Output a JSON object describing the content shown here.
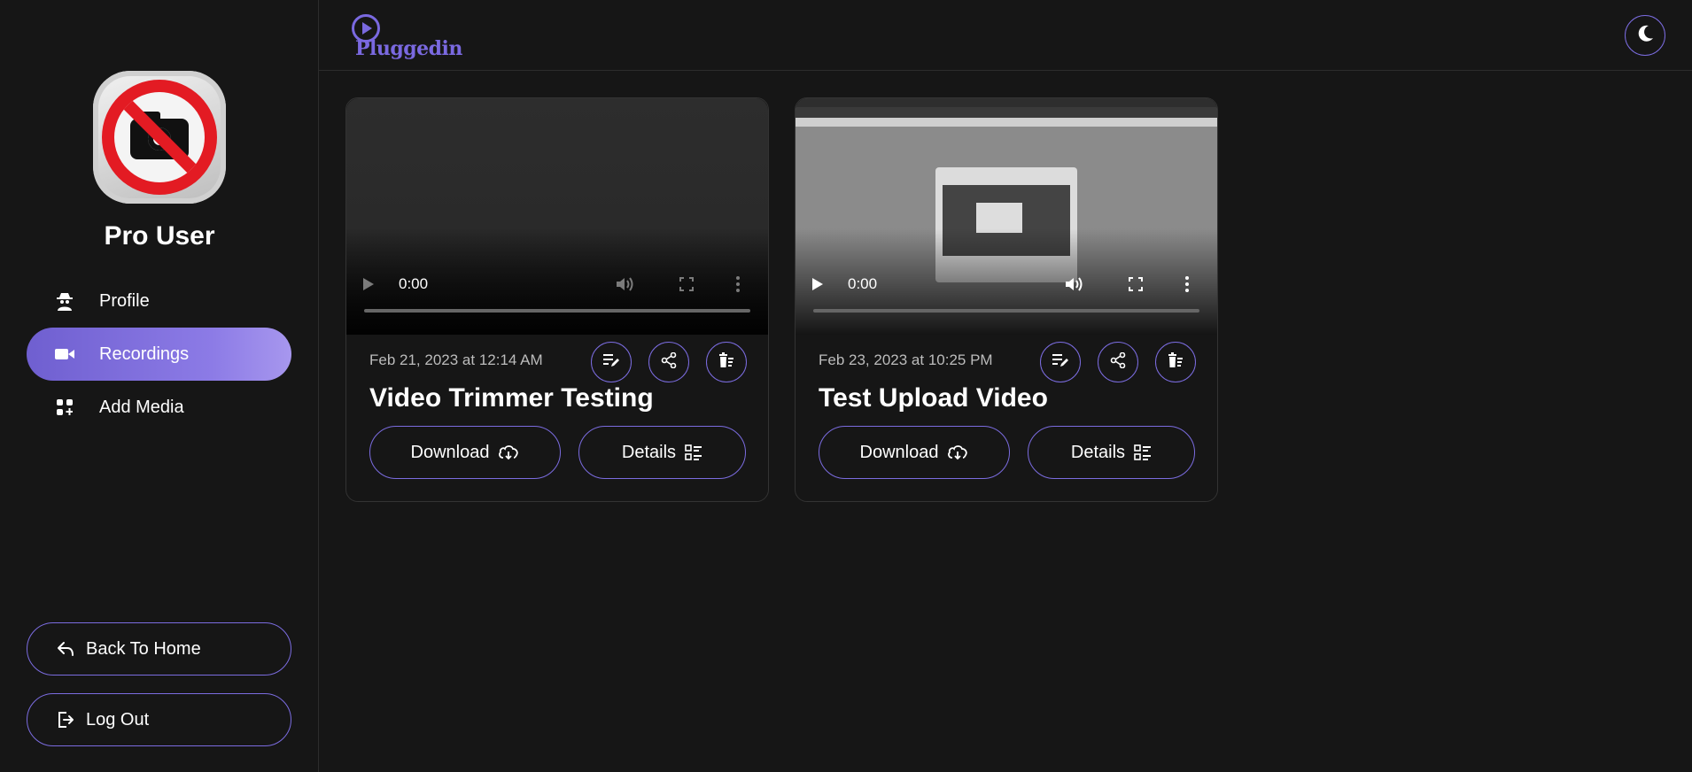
{
  "app": {
    "logo_text": "Pluggedin"
  },
  "sidebar": {
    "username": "Pro User",
    "nav": [
      {
        "label": "Profile",
        "icon": "user-spy-icon"
      },
      {
        "label": "Recordings",
        "icon": "video-camera-icon",
        "active": true
      },
      {
        "label": "Add Media",
        "icon": "grid-add-icon"
      }
    ],
    "back_home_label": "Back To Home",
    "logout_label": "Log Out"
  },
  "header": {
    "theme_toggle_icon": "moon-icon"
  },
  "recordings": [
    {
      "date": "Feb 21, 2023 at 12:14 AM",
      "title": "Video Trimmer Testing",
      "time": "0:00",
      "download_label": "Download",
      "details_label": "Details"
    },
    {
      "date": "Feb 23, 2023 at 10:25 PM",
      "title": "Test Upload Video",
      "time": "0:00",
      "download_label": "Download",
      "details_label": "Details"
    }
  ],
  "colors": {
    "accent": "#7b6ce0",
    "active_nav": "#8c7be6",
    "background": "#161616"
  }
}
